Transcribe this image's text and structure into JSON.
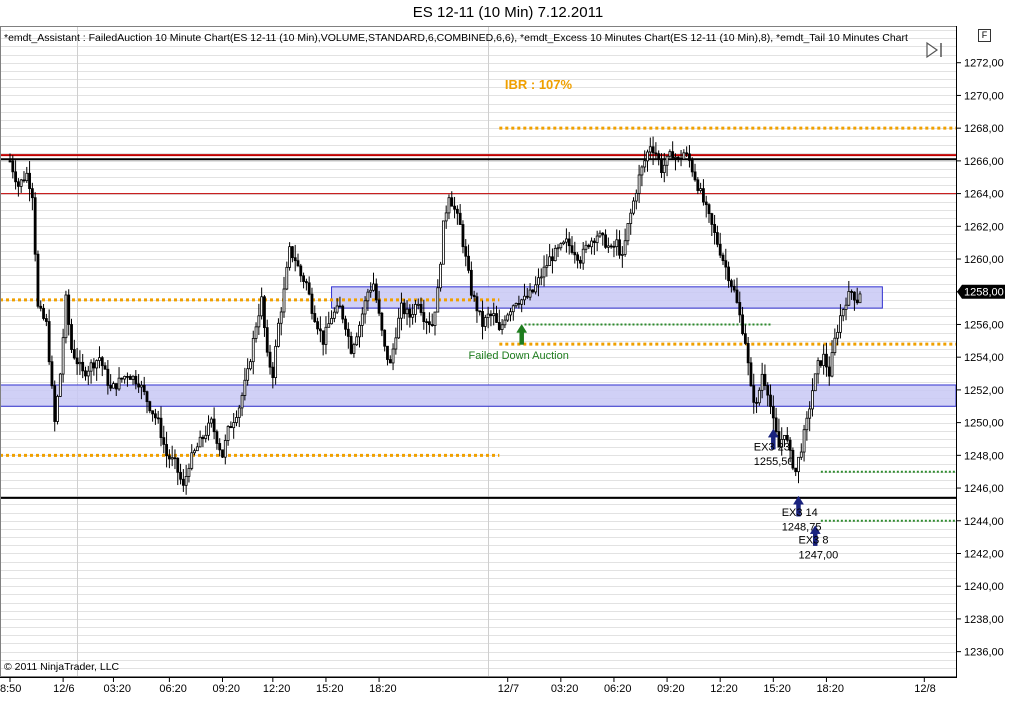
{
  "title": "ES 12-11 (10 Min)  7.12.2011",
  "indicator_text": "*emdt_Assistant : FailedAuction 10 Minute Chart(ES 12-11 (10 Min),VOLUME,STANDARD,6,COMBINED,6,6), *emdt_Excess 10 Minutes Chart(ES 12-11 (10 Min),8), *emdt_Tail 10 Minutes Chart",
  "badge": "F",
  "copyright": "© 2011 NinjaTrader, LLC",
  "colors": {
    "up_candle": "#ffffff",
    "down_candle": "#000000",
    "wick": "#000000",
    "orange_dotted": "#f0a000",
    "green_dotted": "#2e8b2e",
    "band_fill": "#c8c8f4",
    "band_stroke": "#3030d0",
    "red_line": "#c00000",
    "black_line": "#000000",
    "arrow_blue": "#1a237e",
    "arrow_green": "#1e7d1e",
    "grid": "#e2e2e2",
    "price_badge_bg": "#000000",
    "price_badge_fg": "#ffffff",
    "ibr_label": "#f0a000",
    "failed_label": "#1e7d1e"
  },
  "chart_data": {
    "type": "candlestick",
    "title": "ES 12-11 (10 Min)  7.12.2011",
    "ylim": [
      1235,
      1274
    ],
    "y_ticks": [
      1236,
      1238,
      1240,
      1242,
      1244,
      1246,
      1248,
      1250,
      1252,
      1254,
      1256,
      1258,
      1260,
      1262,
      1264,
      1266,
      1268,
      1270,
      1272
    ],
    "y_tick_labels": [
      "1236,00",
      "1238,00",
      "1240,00",
      "1242,00",
      "1244,00",
      "1246,00",
      "1248,00",
      "1250,00",
      "1252,00",
      "1254,00",
      "1256,00",
      "1258,00",
      "1260,00",
      "1262,00",
      "1264,00",
      "1266,00",
      "1268,00",
      "1270,00",
      "1272,00"
    ],
    "x_ticks": [
      {
        "bar": 0,
        "label": "8:50"
      },
      {
        "bar": 19,
        "label": "12/6"
      },
      {
        "bar": 37,
        "label": "03:20"
      },
      {
        "bar": 57,
        "label": "06:20"
      },
      {
        "bar": 76,
        "label": "09:20"
      },
      {
        "bar": 94,
        "label": "12:20"
      },
      {
        "bar": 113,
        "label": "15:20"
      },
      {
        "bar": 132,
        "label": "18:20"
      },
      {
        "bar": 178,
        "label": "12/7"
      },
      {
        "bar": 197,
        "label": "03:20"
      },
      {
        "bar": 216,
        "label": "06:20"
      },
      {
        "bar": 235,
        "label": "09:20"
      },
      {
        "bar": 254,
        "label": "12:20"
      },
      {
        "bar": 273,
        "label": "15:20"
      },
      {
        "bar": 292,
        "label": "18:20"
      },
      {
        "bar": 327,
        "label": "12/8"
      }
    ],
    "session_dividers": [
      24,
      171
    ],
    "last_price": 1258.0,
    "last_price_label": "1258,00",
    "candle_path": [
      [
        0,
        1266.0
      ],
      [
        3,
        1264.5
      ],
      [
        6,
        1265.2
      ],
      [
        8,
        1264.0
      ],
      [
        10,
        1257.0
      ],
      [
        13,
        1256.0
      ],
      [
        16,
        1250.0
      ],
      [
        18,
        1253.0
      ],
      [
        20,
        1257.5
      ],
      [
        22,
        1254.5
      ],
      [
        26,
        1253.0
      ],
      [
        32,
        1254.0
      ],
      [
        36,
        1252.0
      ],
      [
        42,
        1253.0
      ],
      [
        46,
        1252.5
      ],
      [
        50,
        1251.0
      ],
      [
        53,
        1250.0
      ],
      [
        56,
        1248.0
      ],
      [
        59,
        1247.5
      ],
      [
        62,
        1246.0
      ],
      [
        64,
        1247.5
      ],
      [
        67,
        1248.5
      ],
      [
        72,
        1250.0
      ],
      [
        74,
        1249.0
      ],
      [
        76,
        1248.0
      ],
      [
        78,
        1249.5
      ],
      [
        82,
        1251.0
      ],
      [
        85,
        1253.0
      ],
      [
        88,
        1256.0
      ],
      [
        90,
        1257.5
      ],
      [
        92,
        1254.0
      ],
      [
        94,
        1253.0
      ],
      [
        96,
        1256.0
      ],
      [
        98,
        1258.0
      ],
      [
        100,
        1260.5
      ],
      [
        102,
        1260.0
      ],
      [
        104,
        1259.0
      ],
      [
        106,
        1258.5
      ],
      [
        108,
        1257.0
      ],
      [
        110,
        1256.0
      ],
      [
        112,
        1255.0
      ],
      [
        115,
        1256.5
      ],
      [
        118,
        1257.0
      ],
      [
        120,
        1256.0
      ],
      [
        122,
        1254.5
      ],
      [
        125,
        1256.0
      ],
      [
        128,
        1258.0
      ],
      [
        130,
        1258.5
      ],
      [
        132,
        1256.5
      ],
      [
        134,
        1254.5
      ],
      [
        136,
        1253.5
      ],
      [
        138,
        1255.5
      ],
      [
        140,
        1257.0
      ],
      [
        143,
        1256.5
      ],
      [
        146,
        1257.5
      ],
      [
        148,
        1256.5
      ],
      [
        151,
        1256.0
      ],
      [
        153,
        1258.0
      ],
      [
        155,
        1262.0
      ],
      [
        157,
        1264.0
      ],
      [
        159,
        1263.0
      ],
      [
        161,
        1262.0
      ],
      [
        163,
        1260.0
      ],
      [
        165,
        1258.0
      ],
      [
        167,
        1257.0
      ],
      [
        169,
        1256.0
      ],
      [
        171,
        1256.5
      ],
      [
        173,
        1256.5
      ],
      [
        175,
        1255.5
      ],
      [
        177,
        1256.5
      ],
      [
        179,
        1257.0
      ],
      [
        181,
        1257.5
      ],
      [
        184,
        1257.5
      ],
      [
        187,
        1258.0
      ],
      [
        190,
        1259.0
      ],
      [
        193,
        1260.0
      ],
      [
        196,
        1260.5
      ],
      [
        199,
        1261.0
      ],
      [
        202,
        1260.5
      ],
      [
        204,
        1260.0
      ],
      [
        207,
        1261.0
      ],
      [
        210,
        1261.5
      ],
      [
        213,
        1261.0
      ],
      [
        215,
        1260.5
      ],
      [
        217,
        1261.0
      ],
      [
        219,
        1260.0
      ],
      [
        221,
        1262.0
      ],
      [
        223,
        1263.5
      ],
      [
        225,
        1265.0
      ],
      [
        227,
        1266.0
      ],
      [
        229,
        1267.0
      ],
      [
        231,
        1266.5
      ],
      [
        233,
        1265.5
      ],
      [
        235,
        1266.0
      ],
      [
        237,
        1266.5
      ],
      [
        239,
        1266.0
      ],
      [
        241,
        1266.5
      ],
      [
        243,
        1266.0
      ],
      [
        245,
        1265.0
      ],
      [
        247,
        1264.0
      ],
      [
        249,
        1263.0
      ],
      [
        251,
        1262.0
      ],
      [
        253,
        1261.0
      ],
      [
        255,
        1260.0
      ],
      [
        257,
        1259.0
      ],
      [
        259,
        1258.0
      ],
      [
        261,
        1256.5
      ],
      [
        263,
        1255.0
      ],
      [
        265,
        1252.0
      ],
      [
        267,
        1251.0
      ],
      [
        269,
        1253.0
      ],
      [
        271,
        1252.0
      ],
      [
        273,
        1250.0
      ],
      [
        275,
        1248.5
      ],
      [
        277,
        1249.5
      ],
      [
        279,
        1248.0
      ],
      [
        281,
        1247.0
      ],
      [
        283,
        1248.5
      ],
      [
        285,
        1250.0
      ],
      [
        287,
        1252.0
      ],
      [
        289,
        1253.5
      ],
      [
        291,
        1254.0
      ],
      [
        293,
        1253.0
      ],
      [
        295,
        1255.0
      ],
      [
        297,
        1256.5
      ],
      [
        299,
        1257.5
      ],
      [
        301,
        1258.0
      ],
      [
        303,
        1257.5
      ],
      [
        304,
        1258.0
      ]
    ],
    "horizontal_lines": [
      {
        "name": "upper-red-line",
        "value": 1266.35,
        "style": "red-thick",
        "from_bar": 0,
        "to_bar": 337
      },
      {
        "name": "upper-black-line",
        "value": 1266.1,
        "style": "black-thick",
        "from_bar": 0,
        "to_bar": 337
      },
      {
        "name": "mid-red-line",
        "value": 1264.0,
        "style": "red-thin",
        "from_bar": 0,
        "to_bar": 337
      },
      {
        "name": "lower-black-line",
        "value": 1245.4,
        "style": "black-thick",
        "from_bar": 0,
        "to_bar": 337
      },
      {
        "name": "orange-1268",
        "value": 1268.0,
        "style": "orange",
        "from_bar": 175,
        "to_bar": 337
      },
      {
        "name": "orange-1257-5",
        "value": 1257.5,
        "style": "orange",
        "from_bar": 0,
        "to_bar": 175
      },
      {
        "name": "orange-1254-8",
        "value": 1254.8,
        "style": "orange",
        "from_bar": 175,
        "to_bar": 337
      },
      {
        "name": "orange-1248",
        "value": 1248.0,
        "style": "orange",
        "from_bar": 0,
        "to_bar": 175
      },
      {
        "name": "green-1256",
        "value": 1256.0,
        "style": "green",
        "from_bar": 184,
        "to_bar": 272
      },
      {
        "name": "green-1247",
        "value": 1247.0,
        "style": "green",
        "from_bar": 290,
        "to_bar": 337
      },
      {
        "name": "green-1244",
        "value": 1244.0,
        "style": "green",
        "from_bar": 290,
        "to_bar": 337
      }
    ],
    "bands": [
      {
        "name": "upper-band",
        "low": 1257.0,
        "high": 1258.3,
        "from_bar": 115,
        "to_bar": 312
      },
      {
        "name": "lower-band",
        "low": 1251.0,
        "high": 1252.3,
        "from_bar": 0,
        "to_bar": 337
      }
    ],
    "arrows": [
      {
        "name": "green-up-arrow",
        "bar": 183,
        "price": 1256.0,
        "color": "green"
      },
      {
        "name": "blue-up-arrow-1",
        "bar": 273,
        "price": 1249.6,
        "color": "blue"
      },
      {
        "name": "blue-up-arrow-2",
        "bar": 282,
        "price": 1245.5,
        "color": "blue"
      },
      {
        "name": "blue-up-arrow-3",
        "bar": 288,
        "price": 1243.7,
        "color": "blue"
      }
    ],
    "annotations": [
      {
        "name": "ibr-label",
        "text": "IBR : 107%",
        "bar": 177,
        "price": 1270.4,
        "color": "orange",
        "bold": true
      },
      {
        "name": "failed-down-auction-label",
        "text": "Failed Down Auction",
        "bar": 164,
        "price": 1253.9,
        "color": "green",
        "bold": false
      },
      {
        "name": "ex3-23-label",
        "text": "EX3  23",
        "bar": 266,
        "price": 1248.3,
        "color": "black",
        "bold": false
      },
      {
        "name": "ex3-23-price",
        "text": "1255,50",
        "bar": 266,
        "price": 1247.4,
        "color": "black",
        "bold": false
      },
      {
        "name": "ex3-14-label",
        "text": "EX3  14",
        "bar": 276,
        "price": 1244.3,
        "color": "black",
        "bold": false
      },
      {
        "name": "ex3-14-price",
        "text": "1248,75",
        "bar": 276,
        "price": 1243.4,
        "color": "black",
        "bold": false
      },
      {
        "name": "ex3-8-label",
        "text": "EX3  8",
        "bar": 282,
        "price": 1242.6,
        "color": "black",
        "bold": false
      },
      {
        "name": "ex3-8-price",
        "text": "1247,00",
        "bar": 282,
        "price": 1241.7,
        "color": "black",
        "bold": false
      }
    ]
  }
}
